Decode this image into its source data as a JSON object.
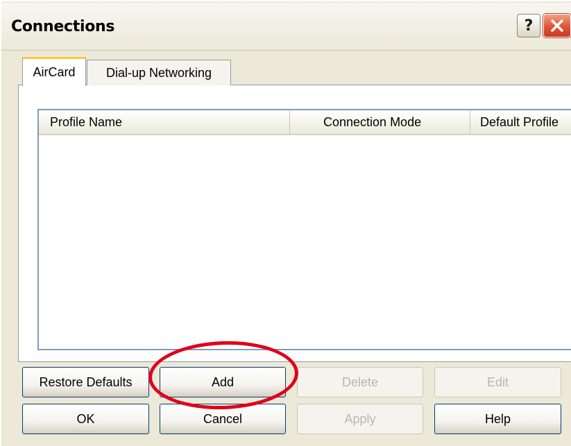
{
  "window": {
    "title": "Connections",
    "help_glyph": "?",
    "close_color": "#e0533a"
  },
  "tabs": [
    {
      "label": "AirCard",
      "active": true
    },
    {
      "label": "Dial-up Networking",
      "active": false
    }
  ],
  "list": {
    "columns": [
      "Profile Name",
      "Connection Mode",
      "Default Profile"
    ],
    "rows": []
  },
  "buttons": {
    "restore_defaults": "Restore Defaults",
    "add": "Add",
    "delete": "Delete",
    "edit": "Edit",
    "ok": "OK",
    "cancel": "Cancel",
    "apply": "Apply",
    "help": "Help"
  },
  "annotation": {
    "ring_color": "#e0001a",
    "target": "Add"
  }
}
